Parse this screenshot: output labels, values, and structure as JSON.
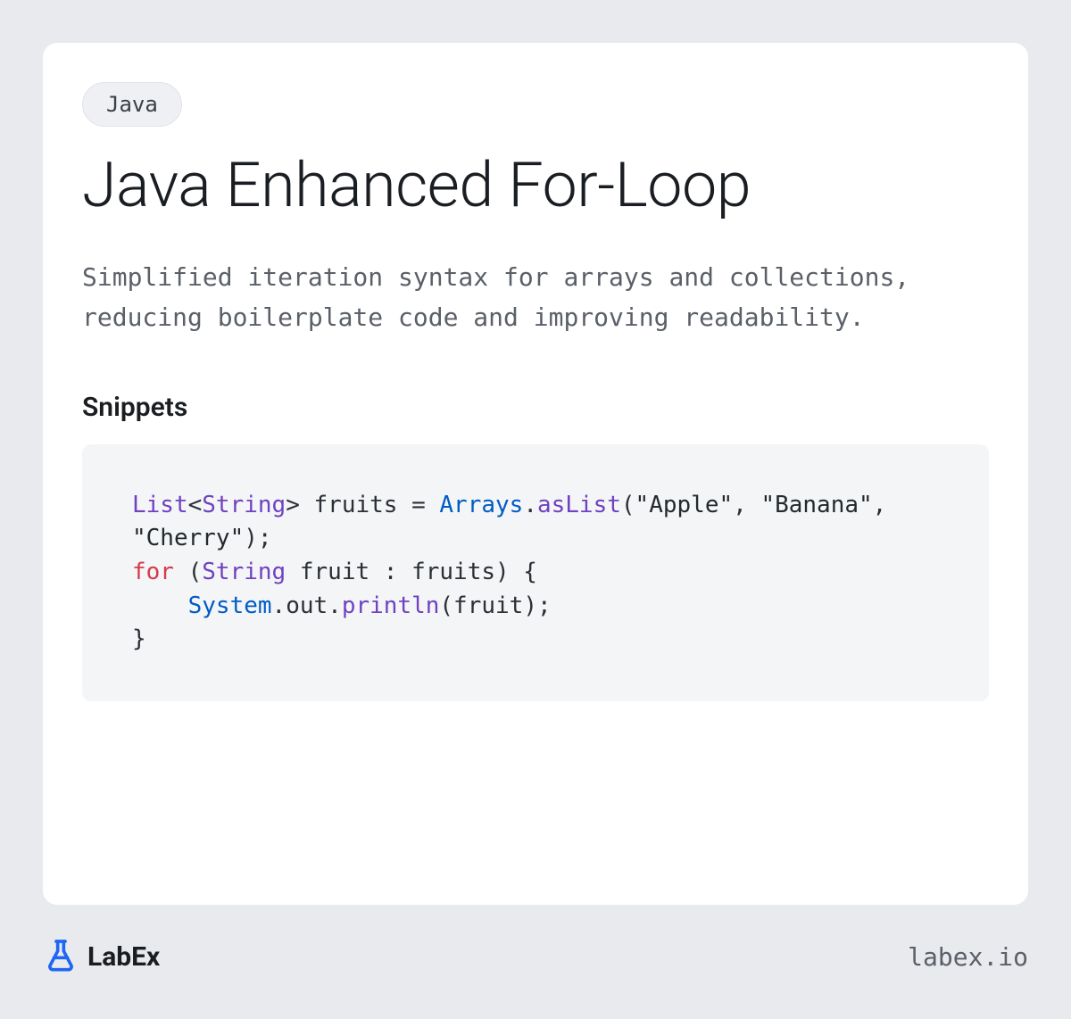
{
  "badge": "Java",
  "title": "Java Enhanced For-Loop",
  "description": "Simplified iteration syntax for arrays and collections, reducing boilerplate code and improving readability.",
  "section_heading": "Snippets",
  "code": {
    "tokens": [
      {
        "t": "List",
        "c": "tok-type"
      },
      {
        "t": "<"
      },
      {
        "t": "String",
        "c": "tok-type"
      },
      {
        "t": "> fruits = "
      },
      {
        "t": "Arrays",
        "c": "tok-builtin"
      },
      {
        "t": "."
      },
      {
        "t": "asList",
        "c": "tok-call"
      },
      {
        "t": "("
      },
      {
        "t": "\"Apple\"",
        "c": "tok-string"
      },
      {
        "t": ", "
      },
      {
        "t": "\"Banana\"",
        "c": "tok-string"
      },
      {
        "t": ", "
      },
      {
        "t": "\"Cherry\"",
        "c": "tok-string"
      },
      {
        "t": ");\n"
      },
      {
        "t": "for",
        "c": "tok-keyword"
      },
      {
        "t": " ("
      },
      {
        "t": "String",
        "c": "tok-type"
      },
      {
        "t": " fruit : fruits) {\n    "
      },
      {
        "t": "System",
        "c": "tok-builtin"
      },
      {
        "t": ".out."
      },
      {
        "t": "println",
        "c": "tok-call"
      },
      {
        "t": "(fruit);\n}"
      }
    ],
    "plain": "List<String> fruits = Arrays.asList(\"Apple\", \"Banana\", \"Cherry\");\nfor (String fruit : fruits) {\n    System.out.println(fruit);\n}"
  },
  "brand": {
    "name": "LabEx",
    "url": "labex.io",
    "icon_color": "#1e66f5"
  }
}
